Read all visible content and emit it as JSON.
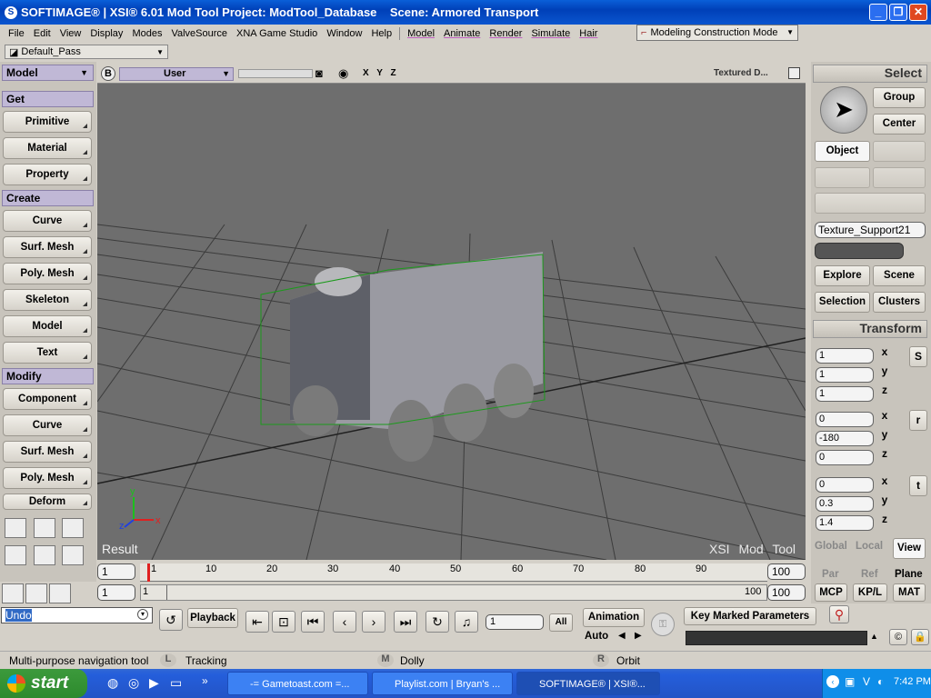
{
  "window": {
    "title": "SOFTIMAGE® | XSI® 6.01 Mod Tool Project: ModTool_Database    Scene: Armored Transport",
    "app_icon": "S"
  },
  "menu": {
    "items": [
      "File",
      "Edit",
      "View",
      "Display",
      "Modes",
      "ValveSource",
      "XNA Game Studio",
      "Window",
      "Help"
    ],
    "modules": [
      "Model",
      "Animate",
      "Render",
      "Simulate",
      "Hair"
    ],
    "mode": "Modeling Construction Mode"
  },
  "pass": {
    "value": "Default_Pass"
  },
  "left_panel": {
    "module": "Model",
    "sections": {
      "get": "Get",
      "create": "Create",
      "modify": "Modify"
    },
    "get_buttons": [
      "Primitive",
      "Material",
      "Property"
    ],
    "create_buttons": [
      "Curve",
      "Surf. Mesh",
      "Poly. Mesh",
      "Skeleton",
      "Model",
      "Text"
    ],
    "modify_buttons": [
      "Component",
      "Curve",
      "Surf. Mesh",
      "Poly. Mesh",
      "Deform"
    ]
  },
  "viewport": {
    "camera": "User",
    "axes_label": "X Y Z",
    "mode": "Textured D...",
    "result_label": "Result",
    "watermark": "XSI Mod Tool",
    "toggle_letter": "B"
  },
  "right_panel": {
    "select_title": "Select",
    "group": "Group",
    "center": "Center",
    "object": "Object",
    "selection_name": "Texture_Support21",
    "explore": "Explore",
    "scene": "Scene",
    "selection": "Selection",
    "clusters": "Clusters",
    "transform_title": "Transform",
    "scale": [
      "1",
      "1",
      "1"
    ],
    "rotate": [
      "0",
      "-180",
      "0"
    ],
    "translate": [
      "0",
      "0.3",
      "1.4"
    ],
    "axes": [
      "x",
      "y",
      "z"
    ],
    "srt": [
      "S",
      "r",
      "t"
    ],
    "global": "Global",
    "local": "Local",
    "view": "View",
    "par": "Par",
    "ref": "Ref",
    "plane": "Plane",
    "mcp": "MCP",
    "kpl": "KP/L",
    "mat": "MAT"
  },
  "timeline": {
    "start": "1",
    "end": "100",
    "ticks": [
      "1",
      "10",
      "20",
      "30",
      "40",
      "50",
      "60",
      "70",
      "80",
      "90"
    ],
    "range_start": "1",
    "range_start_label": "1",
    "range_end_label": "100",
    "range_end": "100"
  },
  "playbar": {
    "undo": "Undo",
    "playback": "Playback",
    "frame": "1",
    "all": "All",
    "animation": "Animation",
    "auto": "Auto",
    "key_marked": "Key Marked Parameters"
  },
  "status": {
    "left": "Multi-purpose navigation tool",
    "l_key": "L",
    "l_text": "Tracking",
    "m_key": "M",
    "m_text": "Dolly",
    "r_key": "R",
    "r_text": "Orbit"
  },
  "taskbar": {
    "start": "start",
    "tasks": [
      "-= Gametoast.com =...",
      "Playlist.com | Bryan's ...",
      "SOFTIMAGE® | XSI®..."
    ],
    "time": "7:42 PM"
  },
  "colors": {
    "title": "#0a55cf",
    "viewport": "#6e6e6e",
    "panel_header": "#c0b8d6",
    "accent_red": "#e02020"
  }
}
